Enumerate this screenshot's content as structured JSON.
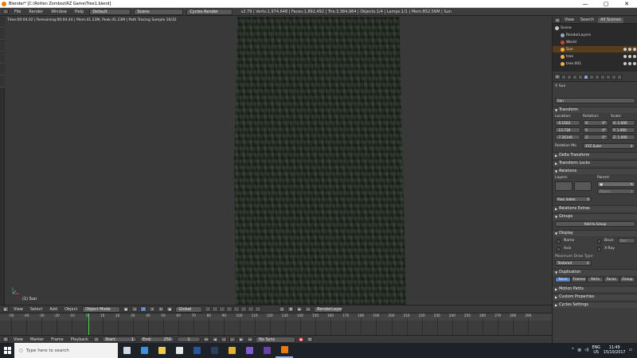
{
  "window": {
    "title": "Blender* [C:\\Rotten Zomboz\\RZ Game\\Tree1.blend]",
    "minimize": "—",
    "maximize": "▢",
    "close": "✕"
  },
  "menubar": {
    "menus": [
      "File",
      "Render",
      "Window",
      "Help"
    ],
    "layout": "Default",
    "scene": "Scene",
    "engine": "Cycles Render",
    "stats": "v2.79 | Verts:1,974,648 | Faces:1,892,492 | Tris:3,384,984 | Objects:1/4 | Lamps:1/1 | Mem:852.56M | Sun"
  },
  "viewport": {
    "render_info": "Time:00:04.02 | Remaining:00:04.44 | Mem:41.23M, Peak:41.23M | Path Tracing Sample 16/32",
    "object_label": "(1) Sun"
  },
  "viewport_header": {
    "menus": [
      "View",
      "Select",
      "Add",
      "Object"
    ],
    "mode": "Object Mode",
    "pivot": "Global",
    "render_layer": "RenderLayer"
  },
  "timeline": {
    "ticks": [
      "-50",
      "-40",
      "-30",
      "-20",
      "-10",
      "0",
      "10",
      "20",
      "30",
      "40",
      "50",
      "60",
      "70",
      "80",
      "90",
      "100",
      "110",
      "120",
      "130",
      "140",
      "150",
      "160",
      "170",
      "180",
      "190",
      "200",
      "210",
      "220",
      "230",
      "240",
      "250",
      "260",
      "270",
      "280",
      "290"
    ],
    "current_frame": 1
  },
  "timeline_header": {
    "menus": [
      "View",
      "Marker",
      "Frame",
      "Playback"
    ],
    "start_label": "Start:",
    "start_value": "1",
    "end_label": "End:",
    "end_value": "250",
    "frame_value": "1",
    "sync": "No Sync"
  },
  "outliner": {
    "tabs": [
      "View",
      "Search",
      "All Scenes"
    ],
    "rows": [
      {
        "label": "Scene",
        "color": "#c8c8c8"
      },
      {
        "label": "RenderLayers",
        "color": "#9aa8bf"
      },
      {
        "label": "World",
        "color": "#c7492b"
      },
      {
        "label": "Sun",
        "color": "#f0b043"
      },
      {
        "label": "tree",
        "color": "#f0b043"
      },
      {
        "label": "tree.001",
        "color": "#f0b043"
      }
    ]
  },
  "properties": {
    "object_breadcrumb": "Sun",
    "object_name": "Sun",
    "transform": {
      "title": "Transform",
      "location_label": "Location:",
      "rotation_label": "Rotation:",
      "scale_label": "Scale:",
      "location": [
        "-0.1503",
        "-13.738",
        "-7.26146"
      ],
      "rotation": [
        {
          "axis": "X:",
          "value": "0°"
        },
        {
          "axis": "Y:",
          "value": "0°"
        },
        {
          "axis": "Z:",
          "value": "0°"
        }
      ],
      "scale": [
        "X: 1.000",
        "Y: 1.000",
        "Z: 1.000"
      ],
      "rotation_mode_label": "Rotation Mo",
      "rotation_mode": "XYZ Euler"
    },
    "sections": {
      "delta": "Delta Transform",
      "locks": "Transform Locks",
      "relations": "Relations",
      "relations_extras": "Relations Extras",
      "groups": "Groups",
      "display": "Display",
      "duplication": "Duplication",
      "motion_paths": "Motion Paths",
      "custom_props": "Custom Properties",
      "cycles": "Cycles Settings"
    },
    "relations": {
      "layers_label": "Layers:",
      "parent_label": "Parent:",
      "parent_type": "Object",
      "pass_index_label": "Pass Index:",
      "pass_index": "0"
    },
    "groups": {
      "add_to_group": "Add to Group"
    },
    "display": {
      "name": "Name",
      "bounds": "Boun",
      "bounds_type": "Box",
      "axis": "Axis",
      "xray": "X-Ray",
      "max_draw_label": "Maximum Draw Type:",
      "max_draw": "Textured"
    },
    "duplication": {
      "options": [
        "None",
        "Frames",
        "Verts",
        "Faces",
        "Group"
      ],
      "active": "None"
    }
  },
  "taskbar": {
    "search_placeholder": "Type here to search",
    "apps": [
      {
        "name": "task-view",
        "color": "#cfd8e3"
      },
      {
        "name": "edge",
        "color": "#3d8fe0"
      },
      {
        "name": "file-explorer",
        "color": "#f2c94c"
      },
      {
        "name": "mail",
        "color": "#e8e8e8"
      },
      {
        "name": "word",
        "color": "#2b579a"
      },
      {
        "name": "steam",
        "color": "#2a3f5a"
      },
      {
        "name": "chrome",
        "color": "#e4b12b"
      },
      {
        "name": "media",
        "color": "#7f5ad2"
      },
      {
        "name": "ps",
        "color": "#6c3fa6"
      },
      {
        "name": "blender",
        "color": "#e87d0d"
      }
    ],
    "lang": "ENG",
    "region": "US",
    "time": "11:49",
    "date": "15/10/2017"
  }
}
